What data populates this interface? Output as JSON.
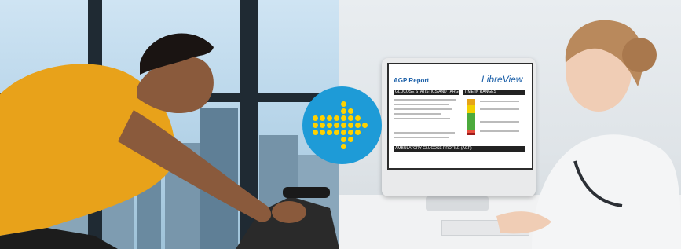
{
  "badge": {
    "icon": "arrow-right-icon",
    "color": "#1e9bd7",
    "dot_color": "#ffd200"
  },
  "monitor": {
    "report_title": "AGP Report",
    "brand": "LibreView",
    "sections": [
      "GLUCOSE STATISTICS AND TARGETS",
      "TIME IN RANGES",
      "AMBULATORY GLUCOSE PROFILE (AGP)"
    ]
  }
}
